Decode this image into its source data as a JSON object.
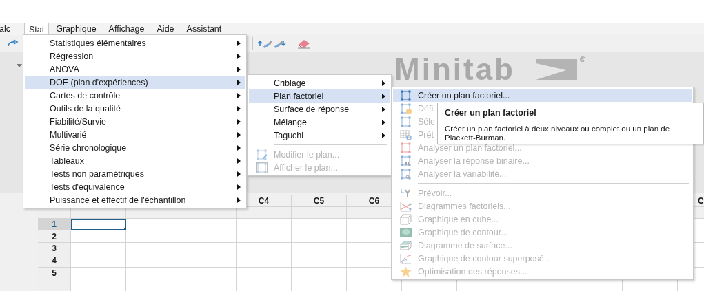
{
  "menubar": [
    {
      "label": "alc",
      "selected": false
    },
    {
      "label": "Stat",
      "selected": true
    },
    {
      "label": "Graphique",
      "selected": false
    },
    {
      "label": "Affichage",
      "selected": false
    },
    {
      "label": "Aide",
      "selected": false
    },
    {
      "label": "Assistant",
      "selected": false
    }
  ],
  "logo": {
    "text": "Minitab",
    "mark": "®"
  },
  "stat_menu": [
    {
      "label": "Statistiques élémentaires",
      "selected": false,
      "submenu": true
    },
    {
      "label": "Régression",
      "selected": false,
      "submenu": true
    },
    {
      "label": "ANOVA",
      "selected": false,
      "submenu": true
    },
    {
      "label": "DOE (plan d'expériences)",
      "selected": true,
      "submenu": true
    },
    {
      "label": "Cartes de contrôle",
      "selected": false,
      "submenu": true
    },
    {
      "label": "Outils de la qualité",
      "selected": false,
      "submenu": true
    },
    {
      "label": "Fiabilité/Survie",
      "selected": false,
      "submenu": true
    },
    {
      "label": "Multivarié",
      "selected": false,
      "submenu": true
    },
    {
      "label": "Série chronologique",
      "selected": false,
      "submenu": true
    },
    {
      "label": "Tableaux",
      "selected": false,
      "submenu": true
    },
    {
      "label": "Tests non paramétriques",
      "selected": false,
      "submenu": true
    },
    {
      "label": "Tests d'équivalence",
      "selected": false,
      "submenu": true
    },
    {
      "label": "Puissance et effectif de l'échantillon",
      "selected": false,
      "submenu": true
    }
  ],
  "doe_menu": [
    {
      "kind": "item",
      "label": "Criblage",
      "selected": false,
      "disabled": false,
      "submenu": true
    },
    {
      "kind": "item",
      "label": "Plan factoriel",
      "selected": true,
      "disabled": false,
      "submenu": true
    },
    {
      "kind": "item",
      "label": "Surface de réponse",
      "selected": false,
      "disabled": false,
      "submenu": true
    },
    {
      "kind": "item",
      "label": "Mélange",
      "selected": false,
      "disabled": false,
      "submenu": true
    },
    {
      "kind": "item",
      "label": "Taguchi",
      "selected": false,
      "disabled": false,
      "submenu": true
    },
    {
      "kind": "separator"
    },
    {
      "kind": "item",
      "label": "Modifier le plan...",
      "selected": false,
      "disabled": true,
      "submenu": false
    },
    {
      "kind": "item",
      "label": "Afficher le plan...",
      "selected": false,
      "disabled": true,
      "submenu": false
    }
  ],
  "factorial_menu": [
    {
      "kind": "item",
      "label": "Créer un plan factoriel...",
      "selected": true,
      "disabled": false
    },
    {
      "kind": "item",
      "label": "Défi",
      "selected": false,
      "disabled": true
    },
    {
      "kind": "item",
      "label": "Séle",
      "selected": false,
      "disabled": true
    },
    {
      "kind": "item",
      "label": "Prét",
      "selected": false,
      "disabled": true
    },
    {
      "kind": "item",
      "label": "Analyser un plan factoriel...",
      "selected": false,
      "disabled": true
    },
    {
      "kind": "item",
      "label": "Analyser la réponse binaire...",
      "selected": false,
      "disabled": true
    },
    {
      "kind": "item",
      "label": "Analyser la variabilité...",
      "selected": false,
      "disabled": true
    },
    {
      "kind": "separator"
    },
    {
      "kind": "item",
      "label": "Prévoir...",
      "selected": false,
      "disabled": true
    },
    {
      "kind": "item",
      "label": "Diagrammes factoriels...",
      "selected": false,
      "disabled": true
    },
    {
      "kind": "item",
      "label": "Graphique en cube...",
      "selected": false,
      "disabled": true
    },
    {
      "kind": "item",
      "label": "Graphique de contour...",
      "selected": false,
      "disabled": true
    },
    {
      "kind": "item",
      "label": "Diagramme de surface...",
      "selected": false,
      "disabled": true
    },
    {
      "kind": "item",
      "label": "Graphique de contour superposé...",
      "selected": false,
      "disabled": true
    },
    {
      "kind": "item",
      "label": "Optimisation des réponses...",
      "selected": false,
      "disabled": true
    }
  ],
  "tooltip": {
    "title": "Créer un plan factoriel",
    "text": "Créer un plan factoriel à deux niveaux ou complet ou un plan de Plackett-Burman."
  },
  "worksheet": {
    "columns": [
      {
        "label": "C4"
      },
      {
        "label": "C5"
      },
      {
        "label": "C6"
      },
      {
        "label": "C"
      }
    ],
    "rows": [
      {
        "label": "1",
        "selected": true
      },
      {
        "label": "2",
        "selected": false
      },
      {
        "label": "3",
        "selected": false
      },
      {
        "label": "4",
        "selected": false
      },
      {
        "label": "5",
        "selected": false
      }
    ]
  }
}
